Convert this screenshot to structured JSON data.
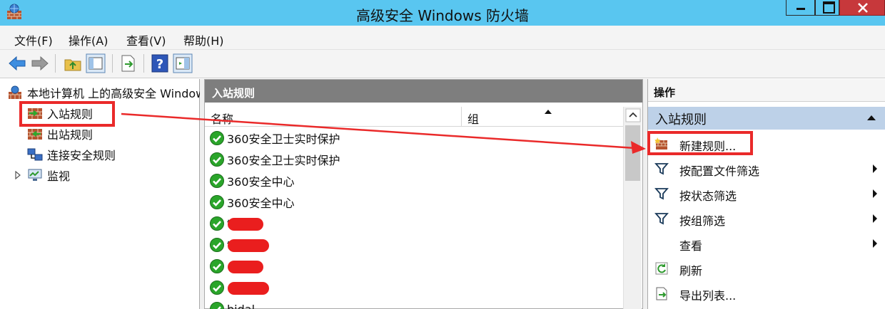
{
  "window": {
    "title": "高级安全 Windows 防火墙"
  },
  "menu": {
    "file": "文件(F)",
    "action": "操作(A)",
    "view": "查看(V)",
    "help": "帮助(H)"
  },
  "toolbar": {
    "help_glyph": "?"
  },
  "tree": {
    "root": "本地计算机 上的高级安全 Windows 防火墙",
    "inbound": "入站规则",
    "outbound": "出站规则",
    "connection_security": "连接安全规则",
    "monitoring": "监视"
  },
  "list": {
    "header": "入站规则",
    "col_name": "名称",
    "col_group": "组",
    "rows": [
      {
        "name": "360安全卫士实时保护",
        "redacted": false
      },
      {
        "name": "360安全卫士实时保护",
        "redacted": false
      },
      {
        "name": "360安全中心",
        "redacted": false
      },
      {
        "name": "360安全中心",
        "redacted": false
      },
      {
        "name": "t",
        "redacted": true
      },
      {
        "name": "t",
        "redacted": true
      },
      {
        "name": "",
        "redacted": true
      },
      {
        "name": "",
        "redacted": true
      },
      {
        "name": "bidal",
        "redacted": false
      }
    ]
  },
  "actions": {
    "title": "操作",
    "group": "入站规则",
    "items": [
      {
        "label": "新建规则...",
        "icon": "new-rule-icon",
        "submenu": false
      },
      {
        "label": "按配置文件筛选",
        "icon": "filter-icon",
        "submenu": true
      },
      {
        "label": "按状态筛选",
        "icon": "filter-icon",
        "submenu": true
      },
      {
        "label": "按组筛选",
        "icon": "filter-icon",
        "submenu": true
      },
      {
        "label": "查看",
        "icon": "",
        "submenu": true
      },
      {
        "label": "刷新",
        "icon": "refresh-icon",
        "submenu": false
      },
      {
        "label": "导出列表...",
        "icon": "export-list-icon",
        "submenu": false
      }
    ]
  },
  "colors": {
    "titlebar": "#59c6f0",
    "annotation": "#ea2a2a",
    "pane_header": "#7e7e7e",
    "actions_group": "#bdd1e8",
    "check_green": "#2aa52a"
  }
}
